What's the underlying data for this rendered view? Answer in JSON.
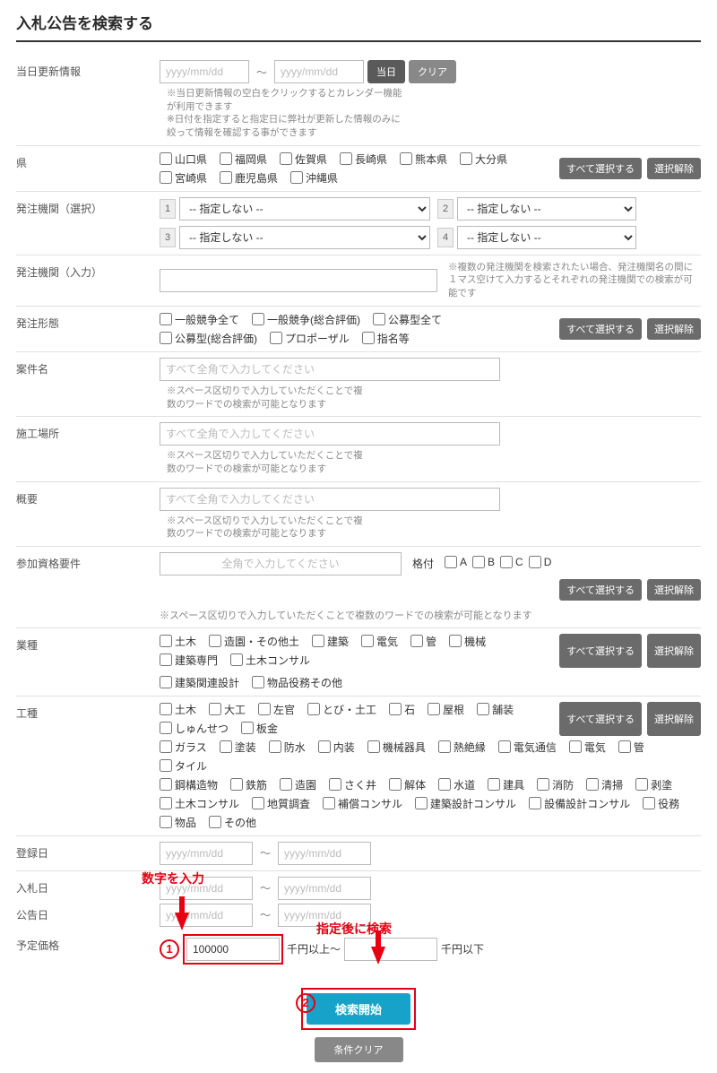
{
  "title": "入札公告を検索する",
  "update": {
    "label": "当日更新情報",
    "placeholder": "yyyy/mm/dd",
    "today_btn": "当日",
    "clear_btn": "クリア",
    "hint": "※当日更新情報の空白をクリックするとカレンダー機能が利用できます\n※日付を指定すると指定日に弊社が更新した情報のみに絞って情報を確認する事ができます"
  },
  "pref": {
    "label": "県",
    "items": [
      "山口県",
      "福岡県",
      "佐賀県",
      "長崎県",
      "熊本県",
      "大分県",
      "宮崎県",
      "鹿児島県",
      "沖縄県"
    ],
    "select_all": "すべて選択する",
    "deselect": "選択解除"
  },
  "org_sel": {
    "label": "発注機関（選択）",
    "opt_none": "-- 指定しない --",
    "n1": "1",
    "n2": "2",
    "n3": "3",
    "n4": "4"
  },
  "org_inp": {
    "label": "発注機関（入力）",
    "hint": "※複数の発注機関を検索されたい場合、発注機関名の間に１マス空けて入力するとそれぞれの発注機関での検索が可能です"
  },
  "form_type": {
    "label": "発注形態",
    "items": [
      "一般競争全て",
      "一般競争(総合評価)",
      "公募型全て",
      "公募型(総合評価)",
      "プロポーザル",
      "指名等"
    ]
  },
  "project": {
    "label": "案件名",
    "placeholder": "すべて全角で入力してください",
    "hint": "※スペース区切りで入力していただくことで複数のワードでの検索が可能となります"
  },
  "place": {
    "label": "施工場所"
  },
  "summary": {
    "label": "概要"
  },
  "qual": {
    "label": "参加資格要件",
    "placeholder": "全角で入力してください",
    "rating_label": "格付",
    "grades": [
      "A",
      "B",
      "C",
      "D"
    ],
    "note": "※スペース区切りで入力していただくことで複数のワードでの検索が可能となります"
  },
  "industry": {
    "label": "業種",
    "row1": [
      "土木",
      "造園・その他土",
      "建築",
      "電気",
      "管",
      "機械",
      "建築専門",
      "土木コンサル"
    ],
    "row2": [
      "建築関連設計",
      "物品役務その他"
    ]
  },
  "category": {
    "label": "工種",
    "row1": [
      "土木",
      "大工",
      "左官",
      "とび・土工",
      "石",
      "屋根",
      "舗装",
      "しゅんせつ",
      "板金"
    ],
    "row2": [
      "ガラス",
      "塗装",
      "防水",
      "内装",
      "機械器具",
      "熱絶縁",
      "電気通信",
      "電気",
      "管",
      "タイル"
    ],
    "row3": [
      "鋼構造物",
      "鉄筋",
      "造園",
      "さく井",
      "解体",
      "水道",
      "建具",
      "消防",
      "清掃",
      "剥塗"
    ],
    "row4": [
      "土木コンサル",
      "地質調査",
      "補償コンサル",
      "建築設計コンサル",
      "設備設計コンサル",
      "役務"
    ],
    "row5": [
      "物品",
      "その他"
    ]
  },
  "reg_date": {
    "label": "登録日"
  },
  "bid_date": {
    "label": "入札日"
  },
  "notice_date": {
    "label": "公告日"
  },
  "price": {
    "label": "予定価格",
    "value": "100000",
    "unit_from": "千円以上～",
    "unit_to": "千円以下"
  },
  "btns": {
    "search": "検索開始",
    "clear": "条件クリア"
  },
  "anno": {
    "txt1": "数字を入力",
    "txt2": "指定後に検索",
    "c1": "1",
    "c2": "2"
  }
}
